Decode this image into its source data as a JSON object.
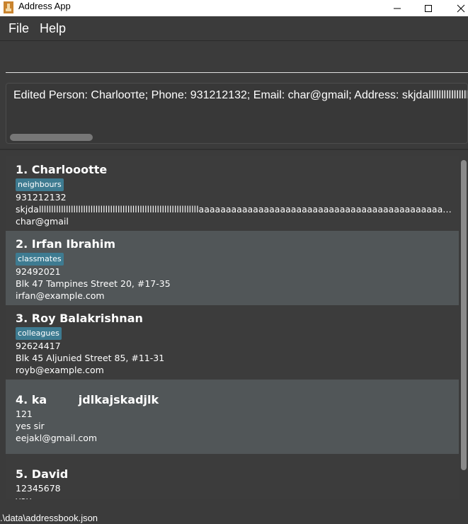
{
  "window": {
    "title": "Address App",
    "icon": "app-icon",
    "controls": [
      "minimize-icon",
      "maximize-icon",
      "close-icon"
    ]
  },
  "menu": {
    "file_label": "File",
    "help_label": "Help"
  },
  "command": {
    "value": ""
  },
  "result": {
    "message": "Edited Person: Charloотte; Phone: 931212132; Email: char@gmail; Address: skjdalllllllllllllllllll"
  },
  "persons": [
    {
      "name": "1. Charloootte",
      "tag": "neighbours",
      "phone": "931212132",
      "address": "skjdalllllllllllllllllllllllllllllllllllllllllllllllllllllllllllllllllaaaaaaaaaaaaaaaaaaaaaaaaaaaaaaaaaaaaaaaaaaaaaaaaaaaaaaaaaaaaaaaaaaaa...",
      "email": "char@gmail"
    },
    {
      "name": "2. Irfan Ibrahim",
      "tag": "classmates",
      "phone": "92492021",
      "address": "Blk 47 Tampines Street 20, #17-35",
      "email": "irfan@example.com"
    },
    {
      "name": "3. Roy Balakrishnan",
      "tag": "colleagues",
      "phone": "92624417",
      "address": "Blk 45 Aljunied Street 85, #11-31",
      "email": "royb@example.com"
    },
    {
      "name": "4. ka        jdlkajskadjlk",
      "phone": "121",
      "address": "yes sir",
      "email": "eejakl@gmail.com"
    },
    {
      "name": "5. David",
      "phone": "12345678",
      "address": "yay"
    }
  ],
  "status": {
    "path": ".\\data\\addressbook.json"
  },
  "colors": {
    "background": "#3b3b3b",
    "card_alt": "#515658",
    "tag": "#3e7b91"
  }
}
